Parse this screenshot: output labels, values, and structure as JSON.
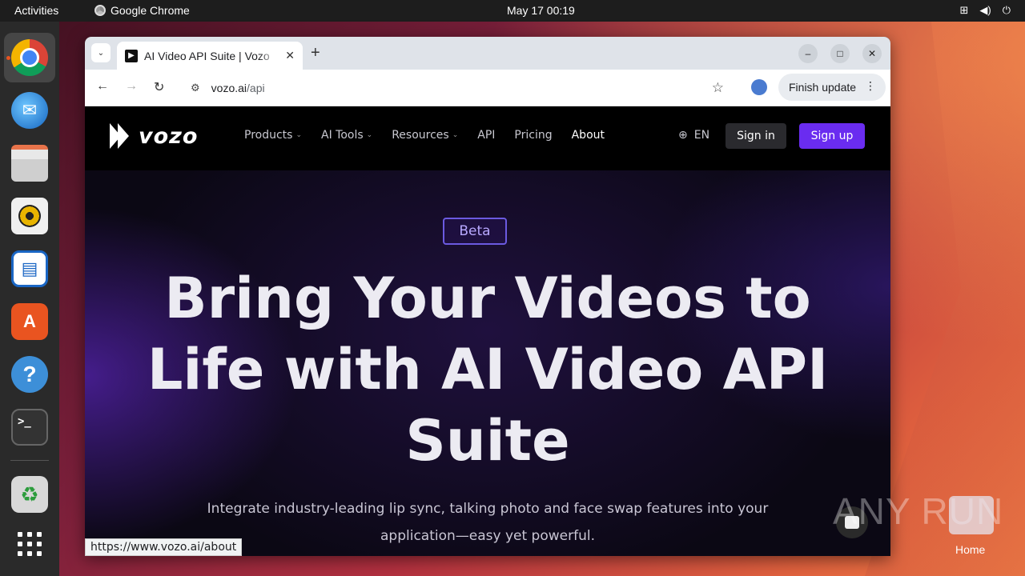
{
  "topbar": {
    "activities": "Activities",
    "app_name": "Google Chrome",
    "clock": "May 17  00:19",
    "tray_icons": [
      "network-icon",
      "volume-icon",
      "power-icon"
    ]
  },
  "dock": {
    "apps": [
      "chrome",
      "thunderbird",
      "files",
      "rhythmbox",
      "libreoffice-writer",
      "app-center",
      "help",
      "terminal",
      "trash",
      "show-apps"
    ]
  },
  "browser": {
    "tab_title": "AI Video API Suite | Vozo",
    "new_tab": "+",
    "url_host": "vozo.ai",
    "url_path": "/api",
    "finish_update": "Finish update",
    "status_url": "https://www.vozo.ai/about"
  },
  "site": {
    "logo": "vozo",
    "nav": {
      "products": "Products",
      "ai_tools": "AI Tools",
      "resources": "Resources",
      "api": "API",
      "pricing": "Pricing",
      "about": "About"
    },
    "lang": "EN",
    "sign_in": "Sign in",
    "sign_up": "Sign up",
    "badge": "Beta",
    "headline": "Bring Your Videos to Life with AI Video API Suite",
    "subtitle": "Integrate industry-leading lip sync, talking photo and face swap features into your application—easy yet powerful."
  },
  "desktop": {
    "home_label": "Home",
    "watermark": "ANY RUN"
  },
  "colors": {
    "accent": "#6a2cf0",
    "ubuntu_orange": "#e95420"
  }
}
